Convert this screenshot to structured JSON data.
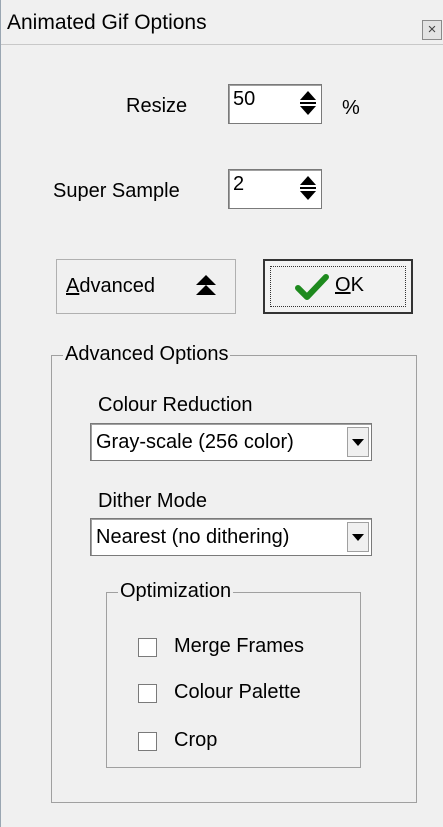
{
  "window": {
    "title": "Animated Gif Options",
    "close_glyph": "×"
  },
  "resize": {
    "label": "Resize",
    "value": "50",
    "unit": "%"
  },
  "super_sample": {
    "label": "Super Sample",
    "value": "2"
  },
  "buttons": {
    "advanced_label_first": "A",
    "advanced_label_rest": "dvanced",
    "ok_label_first": "O",
    "ok_label_rest": "K"
  },
  "advanced_options": {
    "title": "Advanced Options",
    "colour_reduction_label": "Colour Reduction",
    "colour_reduction_value": "Gray-scale (256 color)",
    "dither_mode_label": "Dither Mode",
    "dither_mode_value": "Nearest (no dithering)"
  },
  "optimization": {
    "title": "Optimization",
    "items": [
      {
        "label": "Merge Frames",
        "checked": false
      },
      {
        "label": "Colour Palette",
        "checked": false
      },
      {
        "label": "Crop",
        "checked": false
      }
    ]
  },
  "colors": {
    "ok_check": "#1e8a1e",
    "background": "#f0f0f0"
  }
}
